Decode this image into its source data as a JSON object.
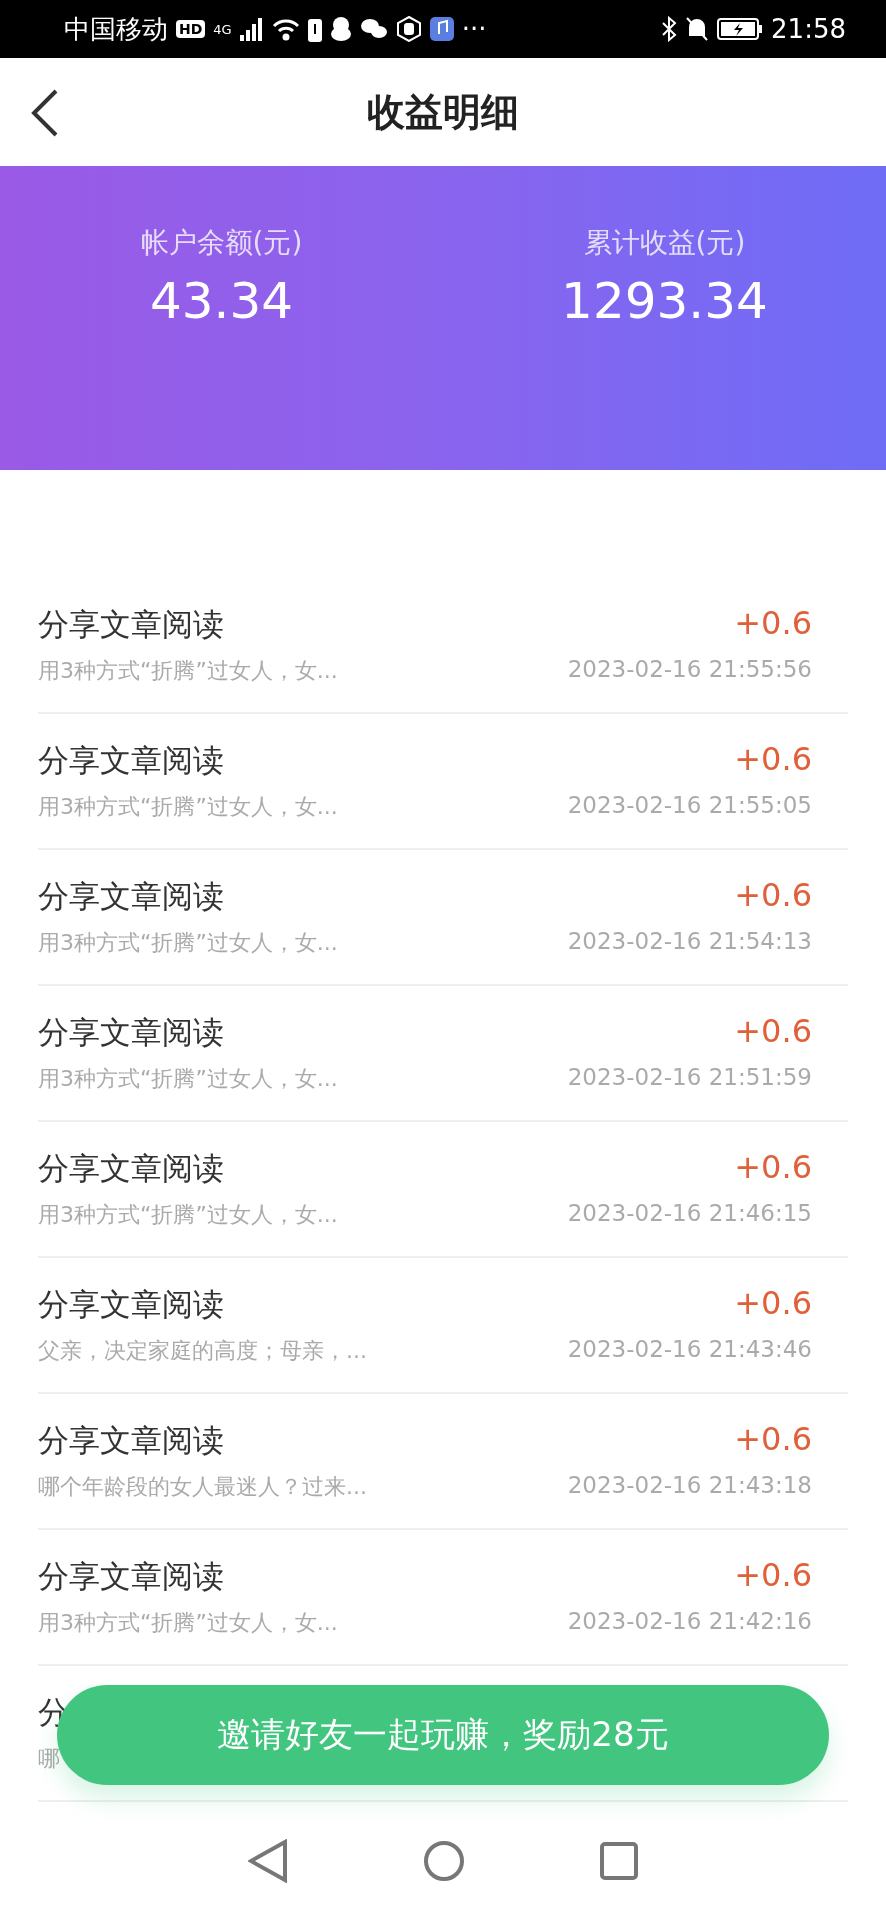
{
  "status_bar": {
    "carrier": "中国移动",
    "hd": "HD",
    "network": "4G",
    "more": "···",
    "time": "21:58"
  },
  "header": {
    "title": "收益明细"
  },
  "summary": [
    {
      "label": "帐户余额(元)",
      "value": "43.34"
    },
    {
      "label": "累计收益(元)",
      "value": "1293.34"
    }
  ],
  "records": [
    {
      "title": "分享文章阅读",
      "subtitle": "用3种方式“折腾”过女人，女...",
      "amount": "+0.6",
      "time": "2023-02-16 21:55:56"
    },
    {
      "title": "分享文章阅读",
      "subtitle": "用3种方式“折腾”过女人，女...",
      "amount": "+0.6",
      "time": "2023-02-16 21:55:05"
    },
    {
      "title": "分享文章阅读",
      "subtitle": "用3种方式“折腾”过女人，女...",
      "amount": "+0.6",
      "time": "2023-02-16 21:54:13"
    },
    {
      "title": "分享文章阅读",
      "subtitle": "用3种方式“折腾”过女人，女...",
      "amount": "+0.6",
      "time": "2023-02-16 21:51:59"
    },
    {
      "title": "分享文章阅读",
      "subtitle": "用3种方式“折腾”过女人，女...",
      "amount": "+0.6",
      "time": "2023-02-16 21:46:15"
    },
    {
      "title": "分享文章阅读",
      "subtitle": "父亲，决定家庭的高度；母亲，...",
      "amount": "+0.6",
      "time": "2023-02-16 21:43:46"
    },
    {
      "title": "分享文章阅读",
      "subtitle": "哪个年龄段的女人最迷人？过来...",
      "amount": "+0.6",
      "time": "2023-02-16 21:43:18"
    },
    {
      "title": "分享文章阅读",
      "subtitle": "用3种方式“折腾”过女人，女...",
      "amount": "+0.6",
      "time": "2023-02-16 21:42:16"
    },
    {
      "title": "分",
      "subtitle": "哪"
    }
  ],
  "invite_button": {
    "label": "邀请好友一起玩赚，奖励28元"
  }
}
